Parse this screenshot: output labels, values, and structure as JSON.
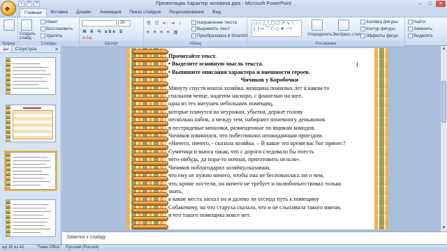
{
  "window": {
    "title": "Презентация Характер человека.pptx - Microsoft PowerPoint"
  },
  "tabs": [
    "Главная",
    "Вставка",
    "Дизайн",
    "Анимация",
    "Показ слайдов",
    "Рецензирование",
    "Вид"
  ],
  "ribbon": {
    "clipboard": {
      "label": "Буфер обм...",
      "paste": "Вставить"
    },
    "slides": {
      "label": "Слайды",
      "create": "Создать слайд",
      "layout": "Макет",
      "reset": "Восстановить",
      "delete": "Удалить"
    },
    "font": {
      "label": "Шрифт",
      "font_name": "",
      "font_size": "20"
    },
    "paragraph": {
      "label": "Абзац",
      "text_direction": "Направление текста",
      "align_text": "Выровнять текст",
      "smartart": "Преобразовать в SmartArt"
    },
    "drawing": {
      "label": "Рисование",
      "arrange": "Упорядочить",
      "quick_styles": "Экспресс-стили",
      "shape_fill": "Заливка фигуры",
      "shape_outline": "Контур фигуры",
      "shape_effects": "Эффекты фигур"
    },
    "editing": {
      "find": "Найти",
      "replace": "Заменить",
      "select": "Выделить"
    }
  },
  "left_pane": {
    "tab_slides": "ды",
    "tab_outline": "Структура"
  },
  "slide": {
    "lines": [
      "Прочитайте текст.",
      "• Выделите основную мысль текста.",
      "• Выпишите описания характера и внешности героев.",
      "Чичиков у Коробочки",
      "Минуту спустя вошла хозяйка, женщина пожилых лет в каком-то",
      "спальном чепце, надетом наскоро, с фланелью на шее,",
      "одна из тех матушек небольших помещиц,",
      "которые плачутся на неурожаи, убытки, держат голову",
      "несколько набок, а между тем, набирают понемногу деньжонок",
      "в пестрядевые мешочки, размещенные по ящикам комодов.",
      "Чичиков извинился, что побеспокоил неожиданным приездом.",
      "«Ничего, ничего, - сказала хозяйка. – В какое это время вас бог принес?",
      "Сумятица и вьюга такая, что с дороги следовало бы поесть",
      " чего-нибудь, да пора-то ночная, приготовить нельзя».",
      "Чичиков поблагодарил хозяйку,сказавши,",
      "что ему не нужно ничего, чтобы  она не беспокоилась ни о чем,",
      "что, кроме постели,  он ничего не требует и полюбопытствовал только",
      "знать,",
      "в какие места заехал он и далеко ли отсюда путь к помещику",
      "Собакевичу, на что старуха сказала, что и не слыхивала такого имени,",
      "и что такого помещика вовсе нет."
    ]
  },
  "notes": {
    "placeholder": "Заметки к слайду"
  },
  "status": {
    "slide_info": "ид 18 из 42",
    "theme": "\"Тема Office\"",
    "language": "Русский (Россия)"
  }
}
